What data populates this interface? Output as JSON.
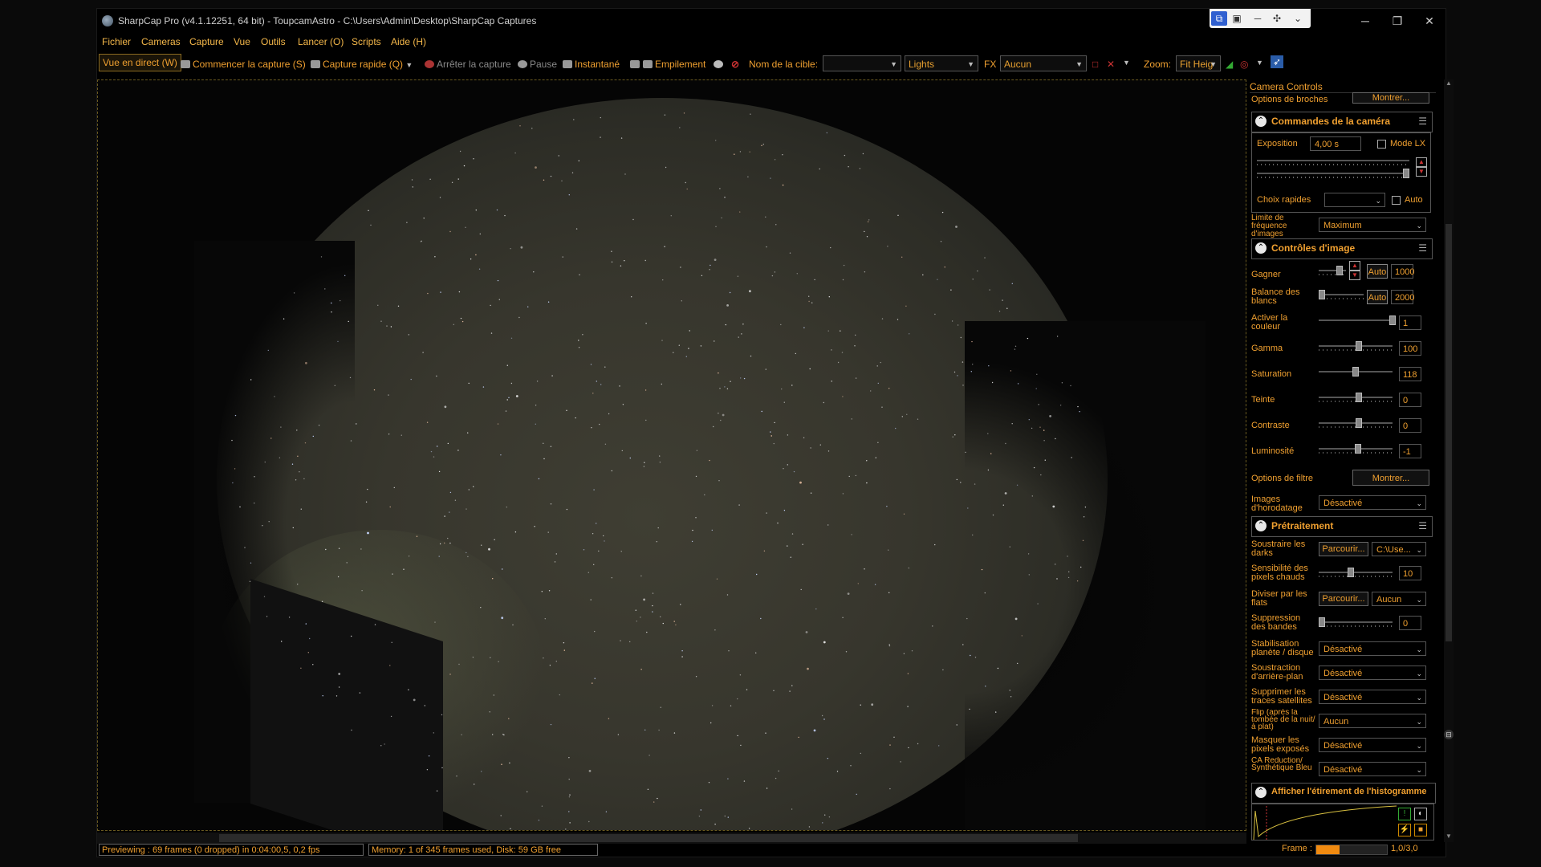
{
  "window": {
    "title": "SharpCap Pro (v4.1.12251, 64 bit) - ToupcamAstro - C:\\Users\\Admin\\Desktop\\SharpCap Captures",
    "minimize": "─",
    "maximize": "❐",
    "close": "✕"
  },
  "menu": [
    "Fichier",
    "Cameras",
    "Capture",
    "Vue",
    "Outils",
    "Lancer (O)",
    "Scripts",
    "Aide (H)"
  ],
  "toolbar": {
    "live_view": "Vue en direct (W)",
    "start_capture": "Commencer la capture (S)",
    "quick_capture": "Capture rapide (Q)",
    "stop_capture": "Arrêter la capture",
    "pause": "Pause",
    "snapshot": "Instantané",
    "stacking": "Empilement",
    "target_name_label": "Nom de la cible:",
    "target_name_value": "",
    "frame_type": "Lights",
    "fx_label": "FX",
    "fx_value": "Aucun",
    "zoom_label": "Zoom:",
    "zoom_value": "Fit Heig"
  },
  "panel": {
    "header": "Camera Controls",
    "pin_options_label": "Options de broches",
    "pin_options_btn": "Montrer...",
    "camera_section": {
      "title": "Commandes de la caméra",
      "exposure_label": "Exposition",
      "exposure_value": "4,00 s",
      "lx_mode_label": "Mode LX",
      "quick_choices_label": "Choix rapides",
      "quick_choices_value": "",
      "auto_label": "Auto",
      "frame_limit_label": "Limite de fréquence d'images",
      "frame_limit_value": "Maximum"
    },
    "image_section": {
      "title": "Contrôles d'image",
      "gain_label": "Gagner",
      "gain_auto": "Auto",
      "gain_value": "1000",
      "wb_label": "Balance des blancs",
      "wb_auto": "Auto",
      "wb_value": "2000",
      "color_label": "Activer la couleur",
      "color_value": "1",
      "gamma_label": "Gamma",
      "gamma_value": "100",
      "saturation_label": "Saturation",
      "saturation_value": "118",
      "hue_label": "Teinte",
      "hue_value": "0",
      "contrast_label": "Contraste",
      "contrast_value": "0",
      "brightness_label": "Luminosité",
      "brightness_value": "-1",
      "filter_options_label": "Options de filtre",
      "filter_options_btn": "Montrer...",
      "timestamp_label": "Images d'horodatage",
      "timestamp_value": "Désactivé"
    },
    "preprocess_section": {
      "title": "Prétraitement",
      "darks_label": "Soustraire les darks",
      "darks_browse": "Parcourir...",
      "darks_value": "C:\\Use...",
      "hotpix_label": "Sensibilité des pixels chauds",
      "hotpix_value": "10",
      "flats_label": "Diviser par les flats",
      "flats_browse": "Parcourir...",
      "flats_value": "Aucun",
      "banding_label": "Suppression des bandes",
      "banding_value": "0",
      "stab_label": "Stabilisation planète / disque",
      "stab_value": "Désactivé",
      "bgsub_label": "Soustraction d'arrière-plan",
      "bgsub_value": "Désactivé",
      "sat_label": "Supprimer les traces satellites",
      "sat_value": "Désactivé",
      "flip_label": "Flip (après la tombée de la nuit/à plat)",
      "flip_value": "Aucun",
      "mask_label": "Masquer les pixels exposés",
      "mask_value": "Désactivé",
      "ca_label": "CA Reduction/ Synthétique Bleu",
      "ca_value": "Désactivé"
    },
    "histogram_section": {
      "title": "Afficher l'étirement de l'histogramme"
    }
  },
  "status": {
    "preview": "Previewing : 69 frames (0 dropped) in 0:04:00,5, 0,2 fps",
    "memory": "Memory: 1 of 345 frames used, Disk: 59 GB free",
    "frame_label": "Frame :",
    "frame_value": "1,0/3,0",
    "frame_progress": 0.33
  },
  "colors": {
    "accent": "#f0a030",
    "background": "#000000",
    "sky": "#3a3930"
  }
}
